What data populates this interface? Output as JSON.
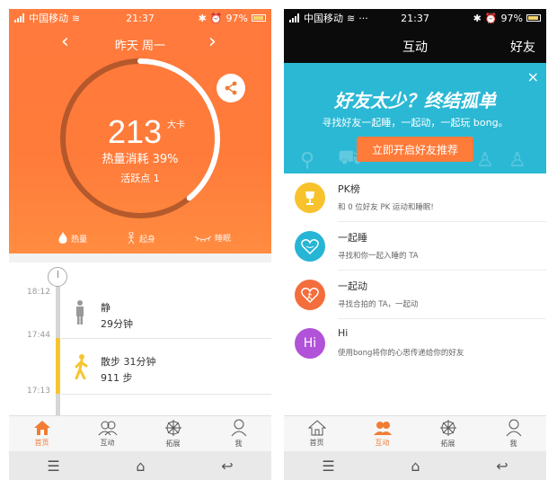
{
  "status": {
    "carrier": "中国移动",
    "time": "21:37",
    "battery": "97%"
  },
  "left": {
    "date": {
      "prev": "‹",
      "label": "昨天  周一",
      "next": "›"
    },
    "calories": {
      "value": "213",
      "unit": "大卡",
      "consumed_text": "热量消耗 39%",
      "progress_fraction": 0.39
    },
    "active_points": "活跃点 1",
    "metric_tabs": [
      {
        "label": "热量",
        "icon": "flame-icon"
      },
      {
        "label": "起身",
        "icon": "stand-icon"
      },
      {
        "label": "睡眠",
        "icon": "sleep-eye-icon"
      }
    ],
    "timeline": {
      "times": [
        "18:12",
        "17:44",
        "17:13"
      ],
      "entries": [
        {
          "title": "静",
          "subtitle": "29分钟",
          "icon": "standing-person-icon"
        },
        {
          "title": "散步 31分钟",
          "subtitle": "911 步",
          "icon": "walking-person-icon"
        }
      ]
    }
  },
  "right": {
    "header": {
      "title": "互动",
      "friends": "好友"
    },
    "banner": {
      "title": "好友太少？终结孤单",
      "subtitle": "寻找好友一起睡，一起动，一起玩 bong。",
      "button": "立即开启好友推荐",
      "close": "×"
    },
    "list": [
      {
        "title": "PK榜",
        "subtitle": "和 0 位好友 PK 运动和睡眠!",
        "color": "#f7c22c",
        "icon": "trophy-icon"
      },
      {
        "title": "一起睡",
        "subtitle": "寻找和你一起入睡的 TA",
        "color": "#27b5d5",
        "icon": "heart-sleep-icon"
      },
      {
        "title": "一起动",
        "subtitle": "寻找合拍的 TA，一起动",
        "color": "#f46d3c",
        "icon": "heart-runner-icon"
      },
      {
        "title": "Hi",
        "subtitle": "使用bong将你的心思传递给你的好友",
        "color": "#b153d8",
        "icon": "hi-icon",
        "avatar_text": "Hi"
      }
    ]
  },
  "tabbar": [
    {
      "label": "首页",
      "icon": "home-icon"
    },
    {
      "label": "互动",
      "icon": "people-icon"
    },
    {
      "label": "拓展",
      "icon": "wheel-icon"
    },
    {
      "label": "我",
      "icon": "person-icon"
    }
  ],
  "colors": {
    "orange": "#ff7a3c",
    "teal": "#2bb8d5",
    "accent_tab": "#f07d35"
  }
}
